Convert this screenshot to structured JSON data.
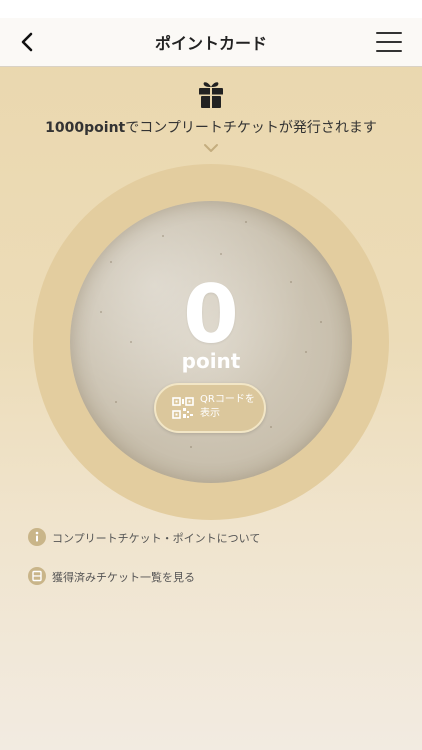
{
  "header": {
    "title": "ポイントカード"
  },
  "reward": {
    "points_goal": "1000point",
    "message_rest": "でコンプリートチケットが発行されます"
  },
  "card": {
    "points": "0",
    "unit": "point",
    "qr_button_label": "QRコードを\n表示"
  },
  "links": [
    {
      "label": "コンプリートチケット・ポイントについて",
      "icon": "info-icon"
    },
    {
      "label": "獲得済みチケット一覧を見る",
      "icon": "ticket-list-icon"
    }
  ],
  "colors": {
    "accent": "#c9b589",
    "ring": "#e3cd9f",
    "background_top": "#ead7ad",
    "background_bottom": "#f2ebe1"
  }
}
